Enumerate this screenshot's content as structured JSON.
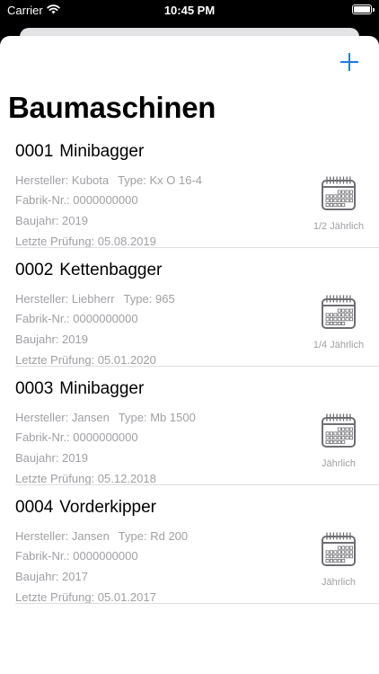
{
  "status": {
    "carrier": "Carrier",
    "time": "10:45 PM"
  },
  "title": "Baumaschinen",
  "labels": {
    "manufacturer": "Hersteller:",
    "type": "Type:",
    "serial": "Fabrik-Nr.:",
    "year": "Baujahr:",
    "inspection": "Letzte Prüfung:"
  },
  "machines": [
    {
      "number": "0001",
      "name": "Minibagger",
      "manufacturer": "Kubota",
      "type": "Kx O 16-4",
      "serial": "0000000000",
      "year": "2019",
      "inspection": "05.08.2019",
      "frequency": "1/2 Jährlich"
    },
    {
      "number": "0002",
      "name": "Kettenbagger",
      "manufacturer": "Liebherr",
      "type": "965",
      "serial": "0000000000",
      "year": "2019",
      "inspection": "05.01.2020",
      "frequency": "1/4 Jährlich"
    },
    {
      "number": "0003",
      "name": "Minibagger",
      "manufacturer": "Jansen",
      "type": "Mb 1500",
      "serial": "0000000000",
      "year": "2019",
      "inspection": "05.12.2018",
      "frequency": "Jährlich"
    },
    {
      "number": "0004",
      "name": "Vorderkipper",
      "manufacturer": "Jansen",
      "type": "Rd 200",
      "serial": "0000000000",
      "year": "2017",
      "inspection": "05.01.2017",
      "frequency": "Jährlich"
    }
  ],
  "colors": {
    "accent": "#1a7cf0",
    "secondary_text": "#a0a0a5",
    "icon_gray": "#6e6e73"
  },
  "icons": {
    "add": "plus-icon",
    "calendar": "calendar-icon"
  }
}
